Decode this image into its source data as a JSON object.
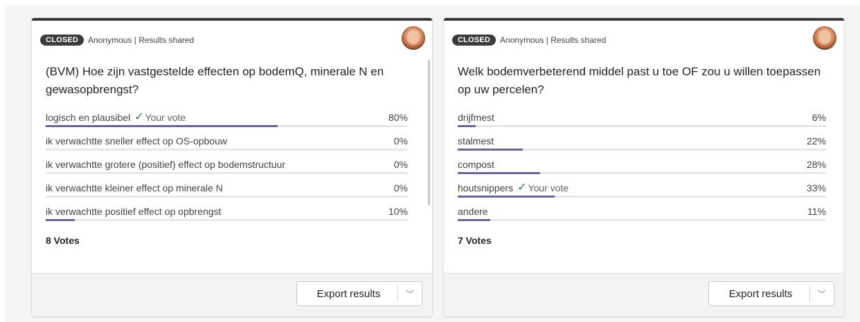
{
  "polls": [
    {
      "status": "CLOSED",
      "meta": "Anonymous | Results shared",
      "question": "(BVM) Hoe zijn vastgestelde effecten op bodemQ, minerale N en gewasopbrengst?",
      "options": [
        {
          "label": "logisch en plausibel",
          "pct_text": "80%",
          "pct": 80,
          "your_vote": true
        },
        {
          "label": "ik verwachtte sneller effect op OS-opbouw",
          "pct_text": "0%",
          "pct": 0,
          "your_vote": false
        },
        {
          "label": "ik verwachtte grotere (positief) effect op bodemstructuur",
          "pct_text": "0%",
          "pct": 0,
          "your_vote": false
        },
        {
          "label": "ik verwachtte kleiner effect op minerale N",
          "pct_text": "0%",
          "pct": 0,
          "your_vote": false
        },
        {
          "label": "ik verwachtte positief effect op opbrengst",
          "pct_text": "10%",
          "pct": 10,
          "your_vote": false
        }
      ],
      "your_vote_label": "Your vote",
      "votes": "8 Votes",
      "export_label": "Export results"
    },
    {
      "status": "CLOSED",
      "meta": "Anonymous | Results shared",
      "question": "Welk bodemverbeterend middel past u toe OF zou u willen toepassen op uw percelen?",
      "options": [
        {
          "label": "drijfmest",
          "pct_text": "6%",
          "pct": 6,
          "your_vote": false
        },
        {
          "label": "stalmest",
          "pct_text": "22%",
          "pct": 22,
          "your_vote": false
        },
        {
          "label": "compost",
          "pct_text": "28%",
          "pct": 28,
          "your_vote": false
        },
        {
          "label": "houtsnippers",
          "pct_text": "33%",
          "pct": 33,
          "your_vote": true
        },
        {
          "label": "andere",
          "pct_text": "11%",
          "pct": 11,
          "your_vote": false
        }
      ],
      "your_vote_label": "Your vote",
      "votes": "7 Votes",
      "export_label": "Export results"
    }
  ],
  "colors": {
    "bar_fill": "#6264a7",
    "bar_track": "#e8e8e8",
    "badge_bg": "#3b3b3b",
    "check": "#237b4b"
  },
  "icons": {
    "vote_check": "checkmark-icon",
    "export_caret": "chevron-down-icon"
  }
}
